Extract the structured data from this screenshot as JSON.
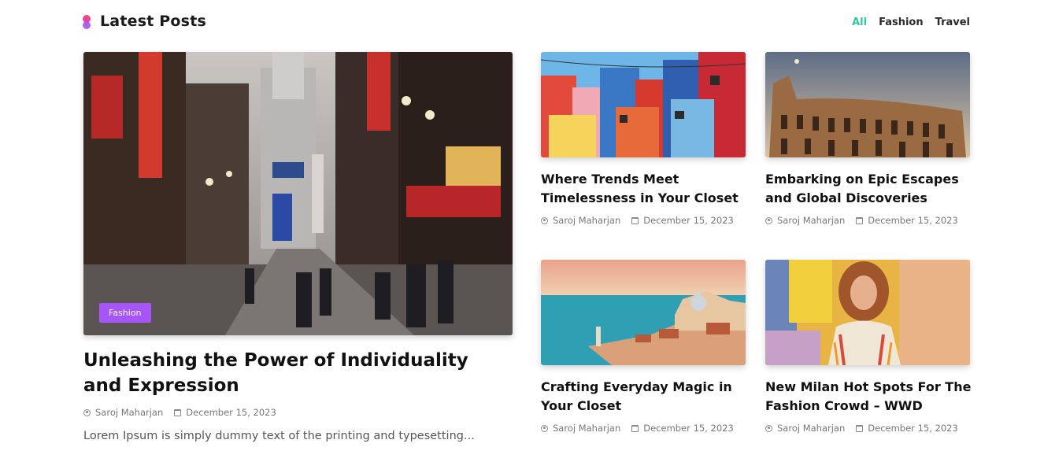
{
  "section": {
    "title": "Latest Posts"
  },
  "filters": [
    {
      "label": "All",
      "active": true
    },
    {
      "label": "Fashion",
      "active": false
    },
    {
      "label": "Travel",
      "active": false
    }
  ],
  "featured": {
    "category": "Fashion",
    "title": "Unleashing the Power of Individuality and Expression",
    "author": "Saroj Maharjan",
    "date": "December 15, 2023",
    "excerpt": "Lorem Ipsum is simply dummy text of the printing and typesetting..."
  },
  "posts": [
    {
      "title": "Where Trends Meet Timelessness in Your Closet",
      "author": "Saroj Maharjan",
      "date": "December 15, 2023"
    },
    {
      "title": "Embarking on Epic Escapes and Global Discoveries",
      "author": "Saroj Maharjan",
      "date": "December 15, 2023"
    },
    {
      "title": "Crafting Everyday Magic in Your Closet",
      "author": "Saroj Maharjan",
      "date": "December 15, 2023"
    },
    {
      "title": "New Milan Hot Spots For The Fashion Crowd – WWD",
      "author": "Saroj Maharjan",
      "date": "December 15, 2023"
    }
  ],
  "colors": {
    "accent_active": "#2fc9a0",
    "badge": "#a855f7",
    "logo_pink": "#f0448e"
  }
}
